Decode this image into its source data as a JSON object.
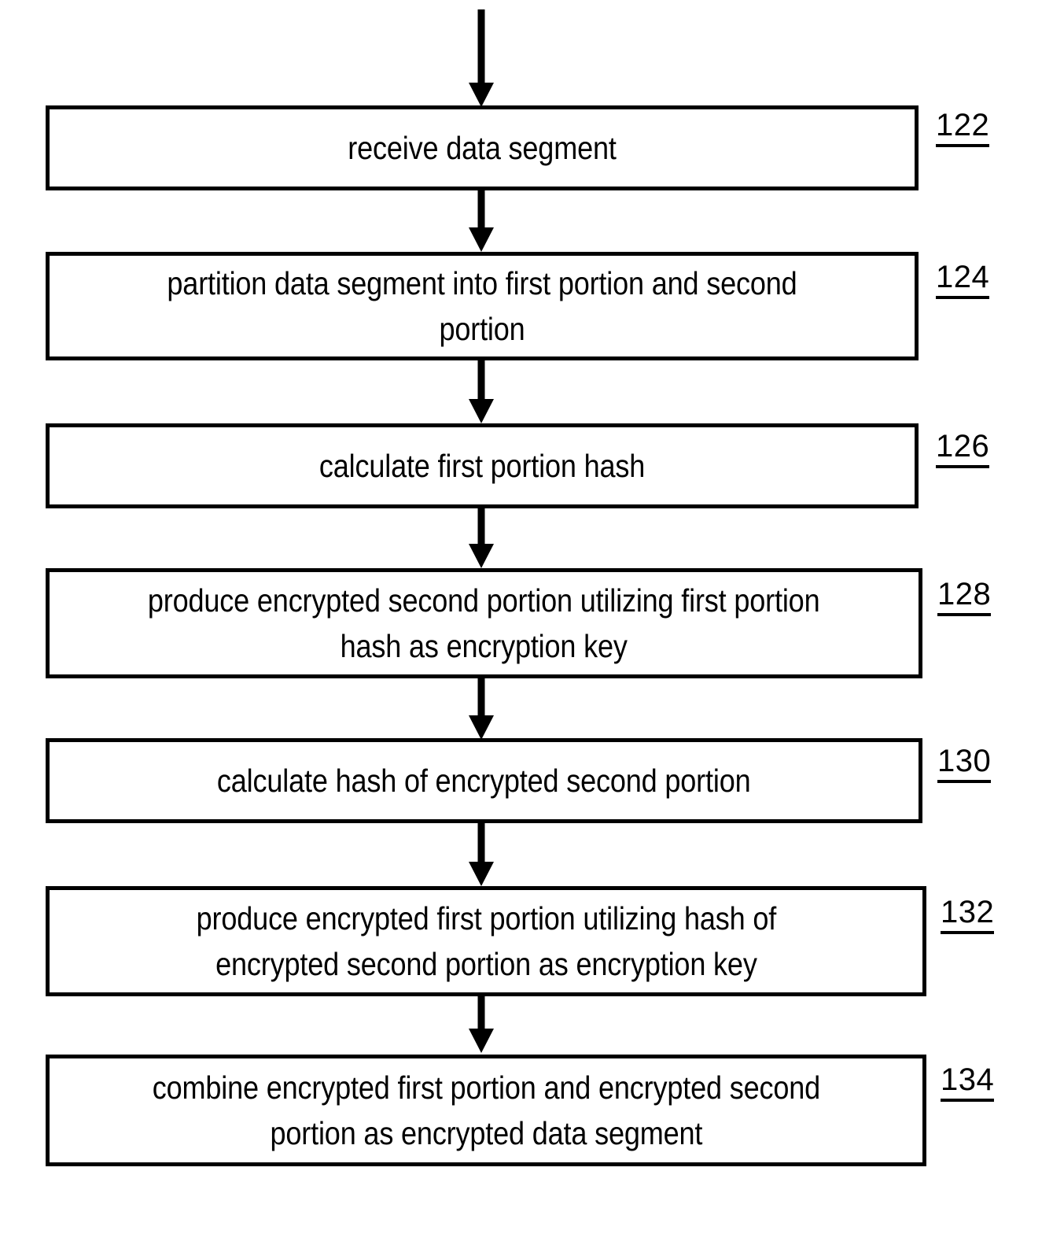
{
  "diagram": {
    "type": "flowchart",
    "title": "",
    "orientation": "vertical",
    "steps": [
      {
        "ref": "122",
        "text": "receive data segment",
        "lines": [
          "receive data segment"
        ]
      },
      {
        "ref": "124",
        "text": "partition data segment into first portion and second portion",
        "lines": [
          "partition data segment into first portion and",
          "second portion"
        ]
      },
      {
        "ref": "126",
        "text": "calculate first portion hash",
        "lines": [
          "calculate first portion hash"
        ]
      },
      {
        "ref": "128",
        "text": "produce encrypted second portion utilizing first portion hash as encryption key",
        "lines": [
          "produce encrypted second portion utilizing first",
          "portion hash as encryption key"
        ]
      },
      {
        "ref": "130",
        "text": "calculate hash of encrypted second portion",
        "lines": [
          "calculate hash of encrypted second portion"
        ]
      },
      {
        "ref": "132",
        "text": "produce encrypted first portion utilizing hash of encrypted second portion as encryption key",
        "lines": [
          "produce encrypted first portion utilizing hash of",
          "encrypted second portion as encryption key"
        ]
      },
      {
        "ref": "134",
        "text": "combine encrypted first portion and encrypted second portion as encrypted data segment",
        "lines": [
          "combine encrypted first portion and encrypted",
          "second portion as encrypted data segment"
        ]
      }
    ],
    "colors": {
      "stroke": "#000000",
      "fill": "#ffffff",
      "text": "#000000"
    }
  }
}
